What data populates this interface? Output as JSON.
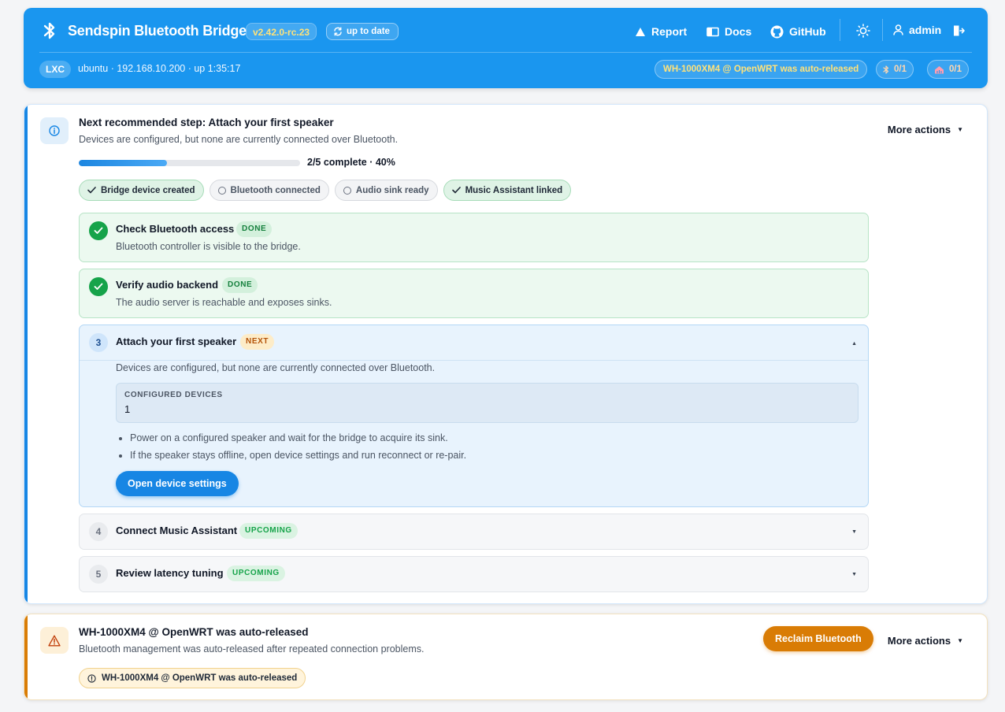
{
  "header": {
    "title": "Sendspin Bluetooth Bridge",
    "version": "v2.42.0-rc.23",
    "update_status": "up to date",
    "nav": {
      "report": "Report",
      "docs": "Docs",
      "github": "GitHub"
    },
    "user": "admin",
    "runtime_badge": "LXC",
    "host_info": "ubuntu · 192.168.10.200 · up 1:35:17",
    "release_chip": "WH-1000XM4 @ OpenWRT was auto-released",
    "bt_count": "0/1",
    "sink_count": "0/1",
    "colors": {
      "bar": "#1a96ef",
      "warning_text": "#ffe27a"
    }
  },
  "onboarding": {
    "title": "Next recommended step: Attach your first speaker",
    "subtitle": "Devices are configured, but none are currently connected over Bluetooth.",
    "more_actions": "More actions",
    "progress_fraction": 0.4,
    "progress_text": "2/5 complete · 40%",
    "chips": [
      {
        "label": "Bridge device created",
        "done": true
      },
      {
        "label": "Bluetooth connected",
        "done": false
      },
      {
        "label": "Audio sink ready",
        "done": false
      },
      {
        "label": "Music Assistant linked",
        "done": true
      }
    ],
    "steps": [
      {
        "title": "Check Bluetooth access",
        "status": "DONE",
        "desc": "Bluetooth controller is visible to the bridge."
      },
      {
        "title": "Verify audio backend",
        "status": "DONE",
        "desc": "The audio server is reachable and exposes sinks."
      },
      {
        "number": "3",
        "title": "Attach your first speaker",
        "status": "NEXT",
        "desc": "Devices are configured, but none are currently connected over Bluetooth.",
        "configured_label": "CONFIGURED DEVICES",
        "configured_value": "1",
        "hints": [
          "Power on a configured speaker and wait for the bridge to acquire its sink.",
          "If the speaker stays offline, open device settings and run reconnect or re-pair."
        ],
        "button": "Open device settings"
      },
      {
        "number": "4",
        "title": "Connect Music Assistant",
        "status": "UPCOMING"
      },
      {
        "number": "5",
        "title": "Review latency tuning",
        "status": "UPCOMING"
      }
    ]
  },
  "alert": {
    "title": "WH-1000XM4 @ OpenWRT was auto-released",
    "subtitle": "Bluetooth management was auto-released after repeated connection problems.",
    "button": "Reclaim Bluetooth",
    "more_actions": "More actions",
    "chip": "WH-1000XM4 @ OpenWRT was auto-released",
    "colors": {
      "accent": "#d97c05"
    }
  }
}
